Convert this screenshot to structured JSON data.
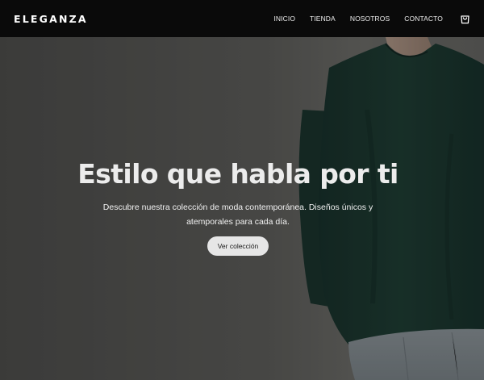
{
  "header": {
    "logo": "ELEGANZA",
    "nav": [
      {
        "label": "INICIO"
      },
      {
        "label": "TIENDA"
      },
      {
        "label": "NOSOTROS"
      },
      {
        "label": "CONTACTO"
      }
    ],
    "cart_icon": "shopping-bag-icon"
  },
  "hero": {
    "title": "Estilo que habla por ti",
    "subtitle": "Descubre nuestra colección de moda contemporánea. Diseños únicos y atemporales para cada día.",
    "cta_label": "Ver colección",
    "image_subject": "person-in-dark-green-sweater-photo"
  },
  "colors": {
    "header_bg": "#0a0a0a",
    "hero_bg": "#626260",
    "sweater": "#1b3a30",
    "denim": "#8c9499",
    "cta_bg": "#e6e6e6",
    "text_light": "#ececec"
  }
}
